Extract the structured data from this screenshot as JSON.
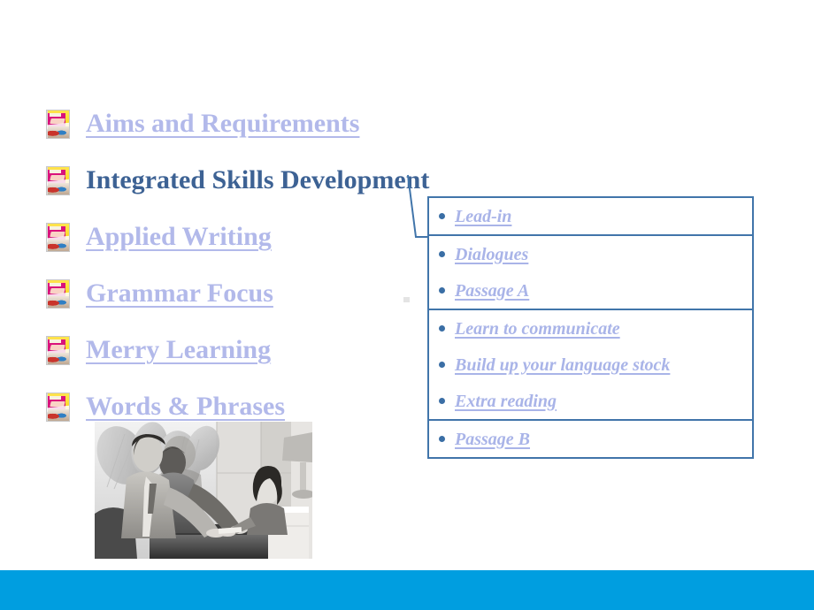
{
  "slide": {
    "background_color": "#ffffff",
    "accent_bar_color": "#009ee0",
    "link_color": "#b2b9ea",
    "current_color": "#3d6294",
    "box_border_color": "#4175aa"
  },
  "menu": {
    "items": [
      {
        "label": "Aims and Requirements",
        "icon": "book-icon",
        "state": "link"
      },
      {
        "label": "Integrated Skills Development",
        "icon": "book-icon",
        "state": "current"
      },
      {
        "label": "Applied Writing",
        "icon": "book-icon",
        "state": "link"
      },
      {
        "label": "Grammar Focus",
        "icon": "book-icon",
        "state": "link"
      },
      {
        "label": "Merry Learning",
        "icon": "book-icon",
        "state": "link"
      },
      {
        "label": "Words & Phrases",
        "icon": "book-icon",
        "state": "link"
      }
    ]
  },
  "sublist": {
    "groups": [
      {
        "items": [
          {
            "label": "Lead-in"
          }
        ]
      },
      {
        "items": [
          {
            "label": "Dialogues"
          },
          {
            "label": "Passage A"
          }
        ]
      },
      {
        "items": [
          {
            "label": "Learn to communicate"
          },
          {
            "label": "Build up your language stock"
          },
          {
            "label": "Extra reading"
          }
        ]
      },
      {
        "items": [
          {
            "label": "Passage B"
          }
        ]
      }
    ]
  },
  "photo": {
    "alt": "hotel-reception-check-in-photo"
  }
}
